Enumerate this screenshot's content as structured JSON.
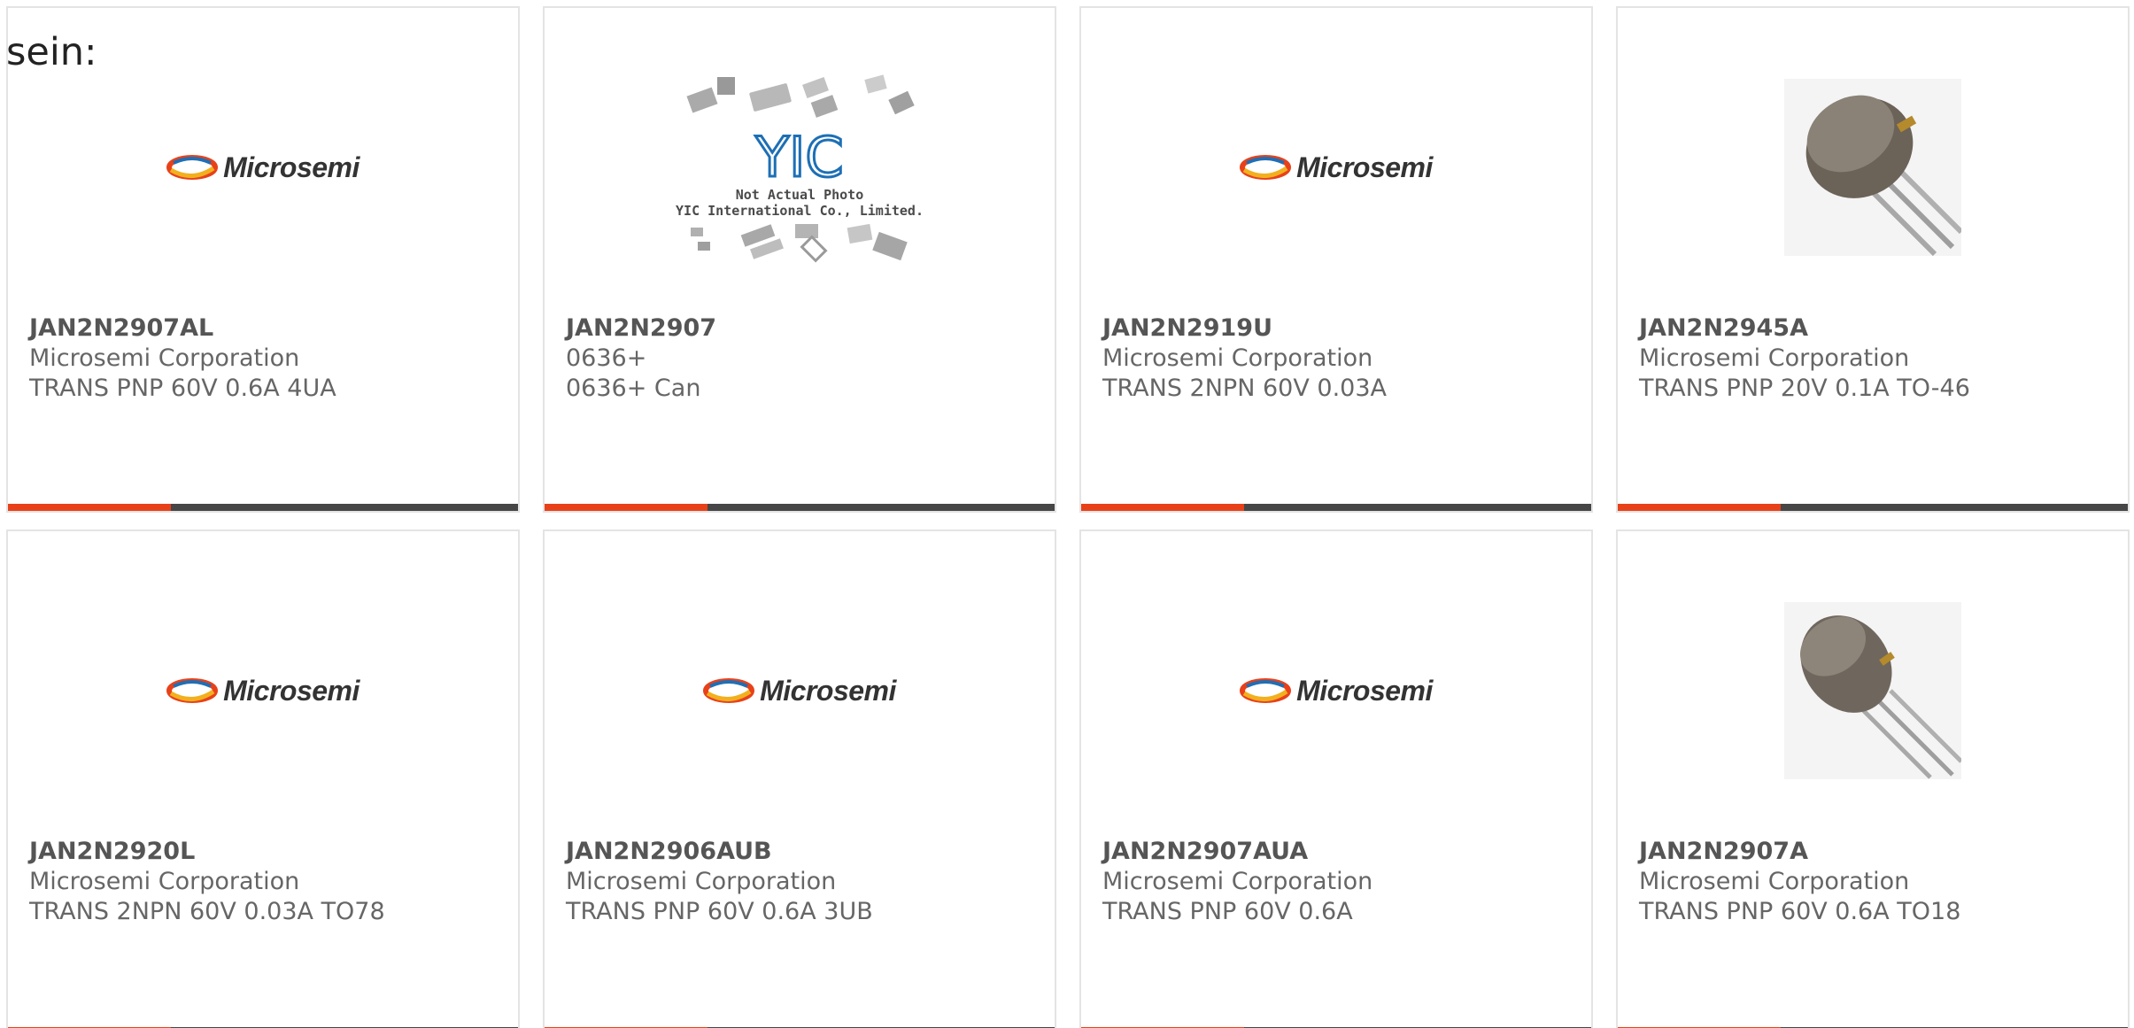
{
  "heading": "sein:",
  "products": [
    {
      "part": "JAN2N2907AL",
      "manufacturer": "Microsemi Corporation",
      "description": "TRANS PNP 60V 0.6A 4UA",
      "image": "microsemi-logo"
    },
    {
      "part": "JAN2N2907",
      "manufacturer": "0636+",
      "description": "0636+ Can",
      "image": "yic-placeholder",
      "image_text": {
        "logo": "YIC",
        "line1": "Not Actual Photo",
        "line2": "YIC International Co., Limited."
      }
    },
    {
      "part": "JAN2N2919U",
      "manufacturer": "Microsemi Corporation",
      "description": "TRANS 2NPN 60V 0.03A",
      "image": "microsemi-logo"
    },
    {
      "part": "JAN2N2945A",
      "manufacturer": "Microsemi Corporation",
      "description": "TRANS PNP 20V 0.1A TO-46",
      "image": "transistor-can-photo"
    },
    {
      "part": "JAN2N2920L",
      "manufacturer": "Microsemi Corporation",
      "description": "TRANS 2NPN 60V 0.03A TO78",
      "image": "microsemi-logo"
    },
    {
      "part": "JAN2N2906AUB",
      "manufacturer": "Microsemi Corporation",
      "description": "TRANS PNP 60V 0.6A 3UB",
      "image": "microsemi-logo"
    },
    {
      "part": "JAN2N2907AUA",
      "manufacturer": "Microsemi Corporation",
      "description": "TRANS PNP 60V 0.6A",
      "image": "microsemi-logo"
    },
    {
      "part": "JAN2N2907A",
      "manufacturer": "Microsemi Corporation",
      "description": "TRANS PNP 60V 0.6A TO18",
      "image": "transistor-can-photo"
    }
  ],
  "logo_text": "Microsemi",
  "colors": {
    "accent": "#e8411a",
    "bar": "#464646",
    "border": "#e4e4e4"
  }
}
